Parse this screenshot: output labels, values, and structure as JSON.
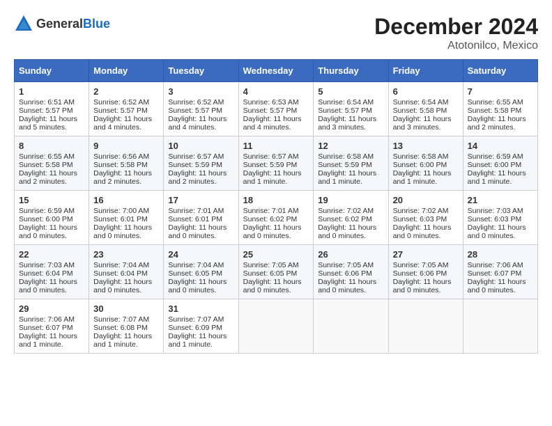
{
  "header": {
    "logo_general": "General",
    "logo_blue": "Blue",
    "month_title": "December 2024",
    "location": "Atotonilco, Mexico"
  },
  "weekdays": [
    "Sunday",
    "Monday",
    "Tuesday",
    "Wednesday",
    "Thursday",
    "Friday",
    "Saturday"
  ],
  "weeks": [
    [
      {
        "day": "1",
        "sunrise": "Sunrise: 6:51 AM",
        "sunset": "Sunset: 5:57 PM",
        "daylight": "Daylight: 11 hours and 5 minutes."
      },
      {
        "day": "2",
        "sunrise": "Sunrise: 6:52 AM",
        "sunset": "Sunset: 5:57 PM",
        "daylight": "Daylight: 11 hours and 4 minutes."
      },
      {
        "day": "3",
        "sunrise": "Sunrise: 6:52 AM",
        "sunset": "Sunset: 5:57 PM",
        "daylight": "Daylight: 11 hours and 4 minutes."
      },
      {
        "day": "4",
        "sunrise": "Sunrise: 6:53 AM",
        "sunset": "Sunset: 5:57 PM",
        "daylight": "Daylight: 11 hours and 4 minutes."
      },
      {
        "day": "5",
        "sunrise": "Sunrise: 6:54 AM",
        "sunset": "Sunset: 5:57 PM",
        "daylight": "Daylight: 11 hours and 3 minutes."
      },
      {
        "day": "6",
        "sunrise": "Sunrise: 6:54 AM",
        "sunset": "Sunset: 5:58 PM",
        "daylight": "Daylight: 11 hours and 3 minutes."
      },
      {
        "day": "7",
        "sunrise": "Sunrise: 6:55 AM",
        "sunset": "Sunset: 5:58 PM",
        "daylight": "Daylight: 11 hours and 2 minutes."
      }
    ],
    [
      {
        "day": "8",
        "sunrise": "Sunrise: 6:55 AM",
        "sunset": "Sunset: 5:58 PM",
        "daylight": "Daylight: 11 hours and 2 minutes."
      },
      {
        "day": "9",
        "sunrise": "Sunrise: 6:56 AM",
        "sunset": "Sunset: 5:58 PM",
        "daylight": "Daylight: 11 hours and 2 minutes."
      },
      {
        "day": "10",
        "sunrise": "Sunrise: 6:57 AM",
        "sunset": "Sunset: 5:59 PM",
        "daylight": "Daylight: 11 hours and 2 minutes."
      },
      {
        "day": "11",
        "sunrise": "Sunrise: 6:57 AM",
        "sunset": "Sunset: 5:59 PM",
        "daylight": "Daylight: 11 hours and 1 minute."
      },
      {
        "day": "12",
        "sunrise": "Sunrise: 6:58 AM",
        "sunset": "Sunset: 5:59 PM",
        "daylight": "Daylight: 11 hours and 1 minute."
      },
      {
        "day": "13",
        "sunrise": "Sunrise: 6:58 AM",
        "sunset": "Sunset: 6:00 PM",
        "daylight": "Daylight: 11 hours and 1 minute."
      },
      {
        "day": "14",
        "sunrise": "Sunrise: 6:59 AM",
        "sunset": "Sunset: 6:00 PM",
        "daylight": "Daylight: 11 hours and 1 minute."
      }
    ],
    [
      {
        "day": "15",
        "sunrise": "Sunrise: 6:59 AM",
        "sunset": "Sunset: 6:00 PM",
        "daylight": "Daylight: 11 hours and 0 minutes."
      },
      {
        "day": "16",
        "sunrise": "Sunrise: 7:00 AM",
        "sunset": "Sunset: 6:01 PM",
        "daylight": "Daylight: 11 hours and 0 minutes."
      },
      {
        "day": "17",
        "sunrise": "Sunrise: 7:01 AM",
        "sunset": "Sunset: 6:01 PM",
        "daylight": "Daylight: 11 hours and 0 minutes."
      },
      {
        "day": "18",
        "sunrise": "Sunrise: 7:01 AM",
        "sunset": "Sunset: 6:02 PM",
        "daylight": "Daylight: 11 hours and 0 minutes."
      },
      {
        "day": "19",
        "sunrise": "Sunrise: 7:02 AM",
        "sunset": "Sunset: 6:02 PM",
        "daylight": "Daylight: 11 hours and 0 minutes."
      },
      {
        "day": "20",
        "sunrise": "Sunrise: 7:02 AM",
        "sunset": "Sunset: 6:03 PM",
        "daylight": "Daylight: 11 hours and 0 minutes."
      },
      {
        "day": "21",
        "sunrise": "Sunrise: 7:03 AM",
        "sunset": "Sunset: 6:03 PM",
        "daylight": "Daylight: 11 hours and 0 minutes."
      }
    ],
    [
      {
        "day": "22",
        "sunrise": "Sunrise: 7:03 AM",
        "sunset": "Sunset: 6:04 PM",
        "daylight": "Daylight: 11 hours and 0 minutes."
      },
      {
        "day": "23",
        "sunrise": "Sunrise: 7:04 AM",
        "sunset": "Sunset: 6:04 PM",
        "daylight": "Daylight: 11 hours and 0 minutes."
      },
      {
        "day": "24",
        "sunrise": "Sunrise: 7:04 AM",
        "sunset": "Sunset: 6:05 PM",
        "daylight": "Daylight: 11 hours and 0 minutes."
      },
      {
        "day": "25",
        "sunrise": "Sunrise: 7:05 AM",
        "sunset": "Sunset: 6:05 PM",
        "daylight": "Daylight: 11 hours and 0 minutes."
      },
      {
        "day": "26",
        "sunrise": "Sunrise: 7:05 AM",
        "sunset": "Sunset: 6:06 PM",
        "daylight": "Daylight: 11 hours and 0 minutes."
      },
      {
        "day": "27",
        "sunrise": "Sunrise: 7:05 AM",
        "sunset": "Sunset: 6:06 PM",
        "daylight": "Daylight: 11 hours and 0 minutes."
      },
      {
        "day": "28",
        "sunrise": "Sunrise: 7:06 AM",
        "sunset": "Sunset: 6:07 PM",
        "daylight": "Daylight: 11 hours and 0 minutes."
      }
    ],
    [
      {
        "day": "29",
        "sunrise": "Sunrise: 7:06 AM",
        "sunset": "Sunset: 6:07 PM",
        "daylight": "Daylight: 11 hours and 1 minute."
      },
      {
        "day": "30",
        "sunrise": "Sunrise: 7:07 AM",
        "sunset": "Sunset: 6:08 PM",
        "daylight": "Daylight: 11 hours and 1 minute."
      },
      {
        "day": "31",
        "sunrise": "Sunrise: 7:07 AM",
        "sunset": "Sunset: 6:09 PM",
        "daylight": "Daylight: 11 hours and 1 minute."
      },
      null,
      null,
      null,
      null
    ]
  ]
}
